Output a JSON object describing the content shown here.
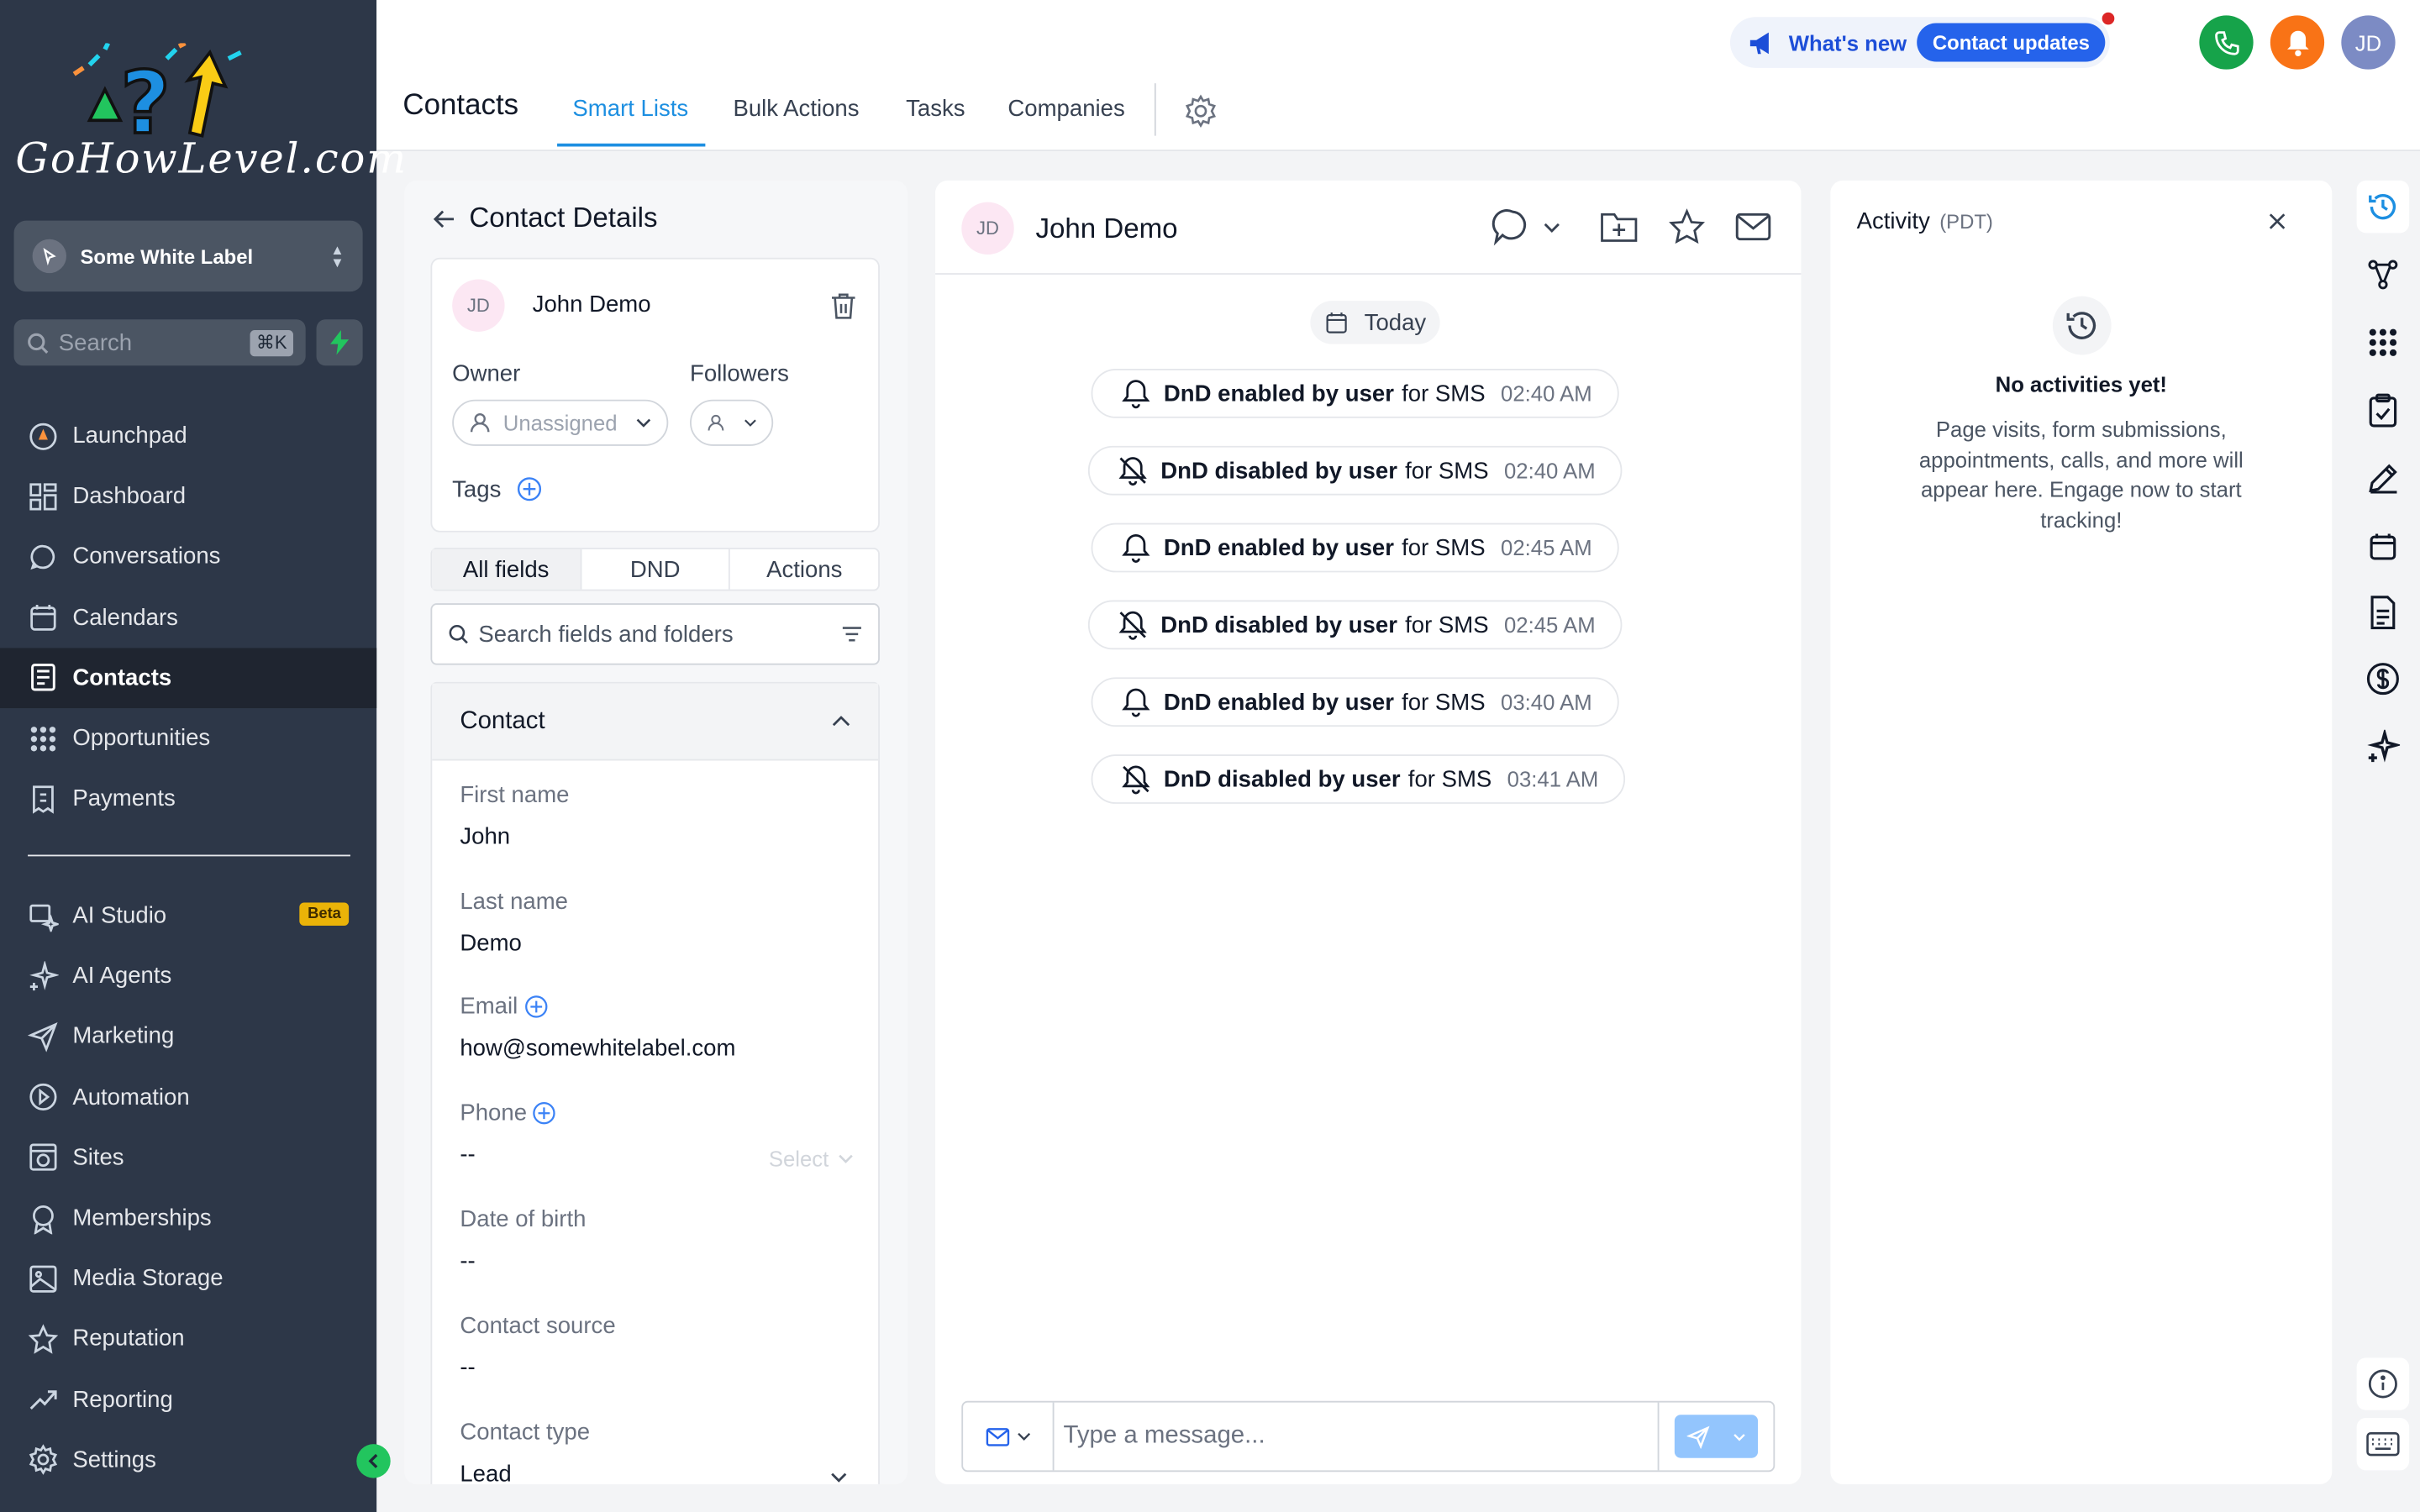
{
  "brand": {
    "logo_text": "GoHowLevel.com",
    "accent": "#1d8fe1",
    "sidebar_bg": "#2d3748"
  },
  "sidebar": {
    "account_name": "Some White Label",
    "search_placeholder": "Search",
    "search_shortcut": "⌘K",
    "items": [
      {
        "label": "Launchpad",
        "icon": "launchpad-icon"
      },
      {
        "label": "Dashboard",
        "icon": "dashboard-icon"
      },
      {
        "label": "Conversations",
        "icon": "chat-icon"
      },
      {
        "label": "Calendars",
        "icon": "calendar-icon"
      },
      {
        "label": "Contacts",
        "icon": "contacts-icon",
        "active": true
      },
      {
        "label": "Opportunities",
        "icon": "opportunities-icon"
      },
      {
        "label": "Payments",
        "icon": "payments-icon"
      }
    ],
    "items2": [
      {
        "label": "AI Studio",
        "icon": "ai-studio-icon",
        "badge": "Beta"
      },
      {
        "label": "AI Agents",
        "icon": "sparkles-icon"
      },
      {
        "label": "Marketing",
        "icon": "send-icon"
      },
      {
        "label": "Automation",
        "icon": "automation-icon"
      },
      {
        "label": "Sites",
        "icon": "sites-icon"
      },
      {
        "label": "Memberships",
        "icon": "memberships-icon"
      },
      {
        "label": "Media Storage",
        "icon": "image-icon"
      },
      {
        "label": "Reputation",
        "icon": "star-icon"
      },
      {
        "label": "Reporting",
        "icon": "trend-icon"
      },
      {
        "label": "Settings",
        "icon": "gear-icon"
      }
    ]
  },
  "header": {
    "title": "Contacts",
    "tabs": [
      "Smart Lists",
      "Bulk Actions",
      "Tasks",
      "Companies"
    ],
    "whats_new": "What's new",
    "contact_updates": "Contact updates",
    "user_initials": "JD"
  },
  "contact_details": {
    "heading": "Contact Details",
    "initials": "JD",
    "name": "John Demo",
    "owner_label": "Owner",
    "owner_value": "Unassigned",
    "followers_label": "Followers",
    "tags_label": "Tags",
    "segments": [
      "All fields",
      "DND",
      "Actions"
    ],
    "search_placeholder": "Search fields and folders",
    "section_title": "Contact",
    "fields": {
      "first_name_label": "First name",
      "first_name": "John",
      "last_name_label": "Last name",
      "last_name": "Demo",
      "email_label": "Email",
      "email": "how@somewhitelabel.com",
      "phone_label": "Phone",
      "phone": "--",
      "phone_select": "Select",
      "dob_label": "Date of birth",
      "dob": "--",
      "source_label": "Contact source",
      "source": "--",
      "type_label": "Contact type",
      "type": "Lead"
    }
  },
  "conversation": {
    "initials": "JD",
    "name": "John Demo",
    "date_chip": "Today",
    "events": [
      {
        "bold": "DnD enabled by user",
        "suffix": "for SMS",
        "time": "02:40 AM",
        "icon": "bell-icon"
      },
      {
        "bold": "DnD disabled by user",
        "suffix": "for SMS",
        "time": "02:40 AM",
        "icon": "bell-off-icon"
      },
      {
        "bold": "DnD enabled by user",
        "suffix": "for SMS",
        "time": "02:45 AM",
        "icon": "bell-icon"
      },
      {
        "bold": "DnD disabled by user",
        "suffix": "for SMS",
        "time": "02:45 AM",
        "icon": "bell-off-icon"
      },
      {
        "bold": "DnD enabled by user",
        "suffix": "for SMS",
        "time": "03:40 AM",
        "icon": "bell-icon"
      },
      {
        "bold": "DnD disabled by user",
        "suffix": "for SMS",
        "time": "03:41 AM",
        "icon": "bell-off-icon"
      }
    ],
    "message_placeholder": "Type a message..."
  },
  "activity": {
    "title": "Activity",
    "tz": "(PDT)",
    "empty_title": "No activities yet!",
    "empty_desc": "Page visits, form submissions, appointments, calls, and more will appear here. Engage now to start tracking!"
  }
}
